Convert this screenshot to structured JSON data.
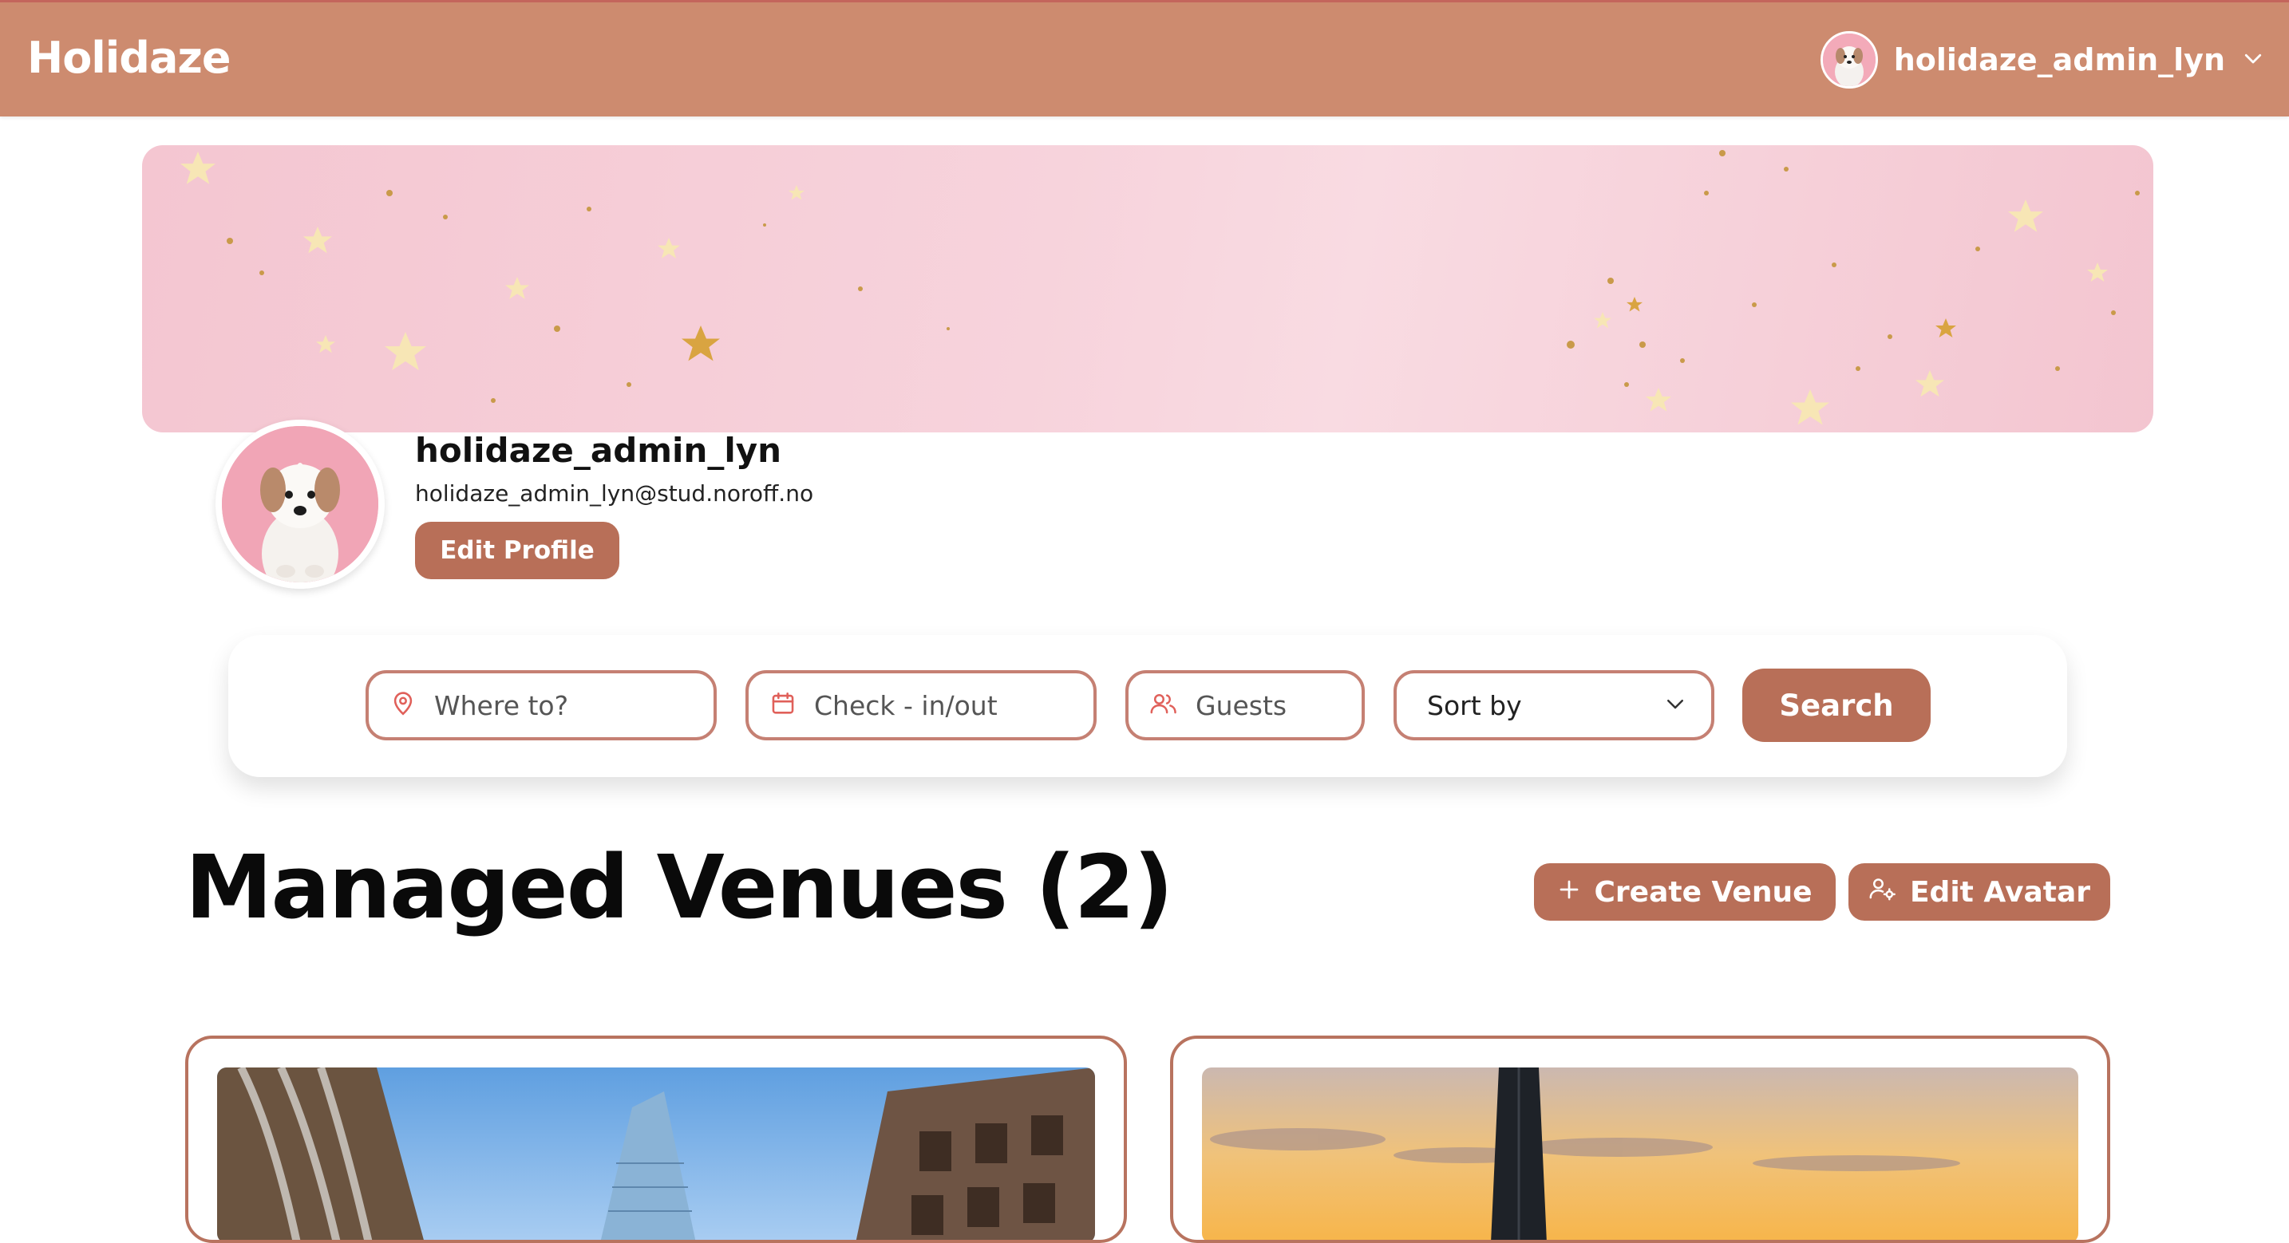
{
  "app": {
    "brand": "Holidaze"
  },
  "nav": {
    "username": "holidaze_admin_lyn"
  },
  "profile": {
    "name": "holidaze_admin_lyn",
    "email": "holidaze_admin_lyn@stud.noroff.no",
    "edit_label": "Edit Profile"
  },
  "search": {
    "where_placeholder": "Where to?",
    "dates_placeholder": "Check - in/out",
    "guests_placeholder": "Guests",
    "sort_value": "Sort by",
    "button_label": "Search"
  },
  "venues": {
    "title": "Managed Venues (2)",
    "create_label": "Create Venue",
    "edit_avatar_label": "Edit Avatar",
    "cards": [
      {
        "image": "city-buildings-image"
      },
      {
        "image": "sunset-tower-image"
      }
    ]
  },
  "icons": {
    "location": "location-pin-icon",
    "calendar": "calendar-icon",
    "guests": "users-icon",
    "sort": "chevron-down-icon",
    "create": "plus-icon",
    "avatar": "user-cog-icon"
  },
  "colors": {
    "primary": "#b86f58",
    "navbar": "#cd8b6f",
    "field_border": "#c58073",
    "icon_accent": "#e0605a",
    "banner": "#f6cfd9"
  }
}
